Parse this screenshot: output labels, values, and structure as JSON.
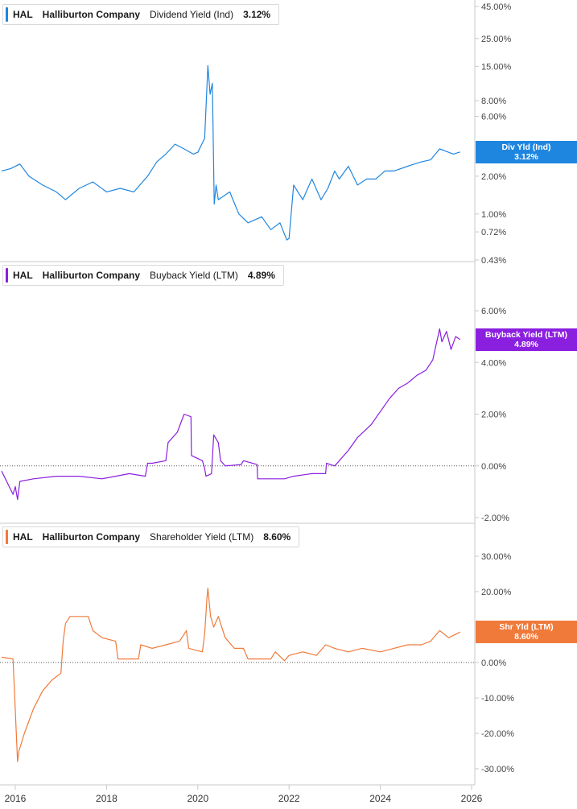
{
  "company": {
    "ticker": "HAL",
    "name": "Halliburton Company"
  },
  "x_axis": {
    "ticks": [
      "2016",
      "2018",
      "2020",
      "2022",
      "2024",
      "2026"
    ]
  },
  "chart_data": [
    {
      "type": "line",
      "series": [
        {
          "name": "Dividend Yield (Ind)",
          "color": "#1f86e0",
          "x": [
            2015.7,
            2015.9,
            2016.1,
            2016.3,
            2016.6,
            2016.9,
            2017.1,
            2017.4,
            2017.7,
            2018.0,
            2018.3,
            2018.6,
            2018.9,
            2019.1,
            2019.3,
            2019.5,
            2019.7,
            2019.9,
            2020.0,
            2020.15,
            2020.22,
            2020.27,
            2020.32,
            2020.36,
            2020.4,
            2020.45,
            2020.7,
            2020.9,
            2021.1,
            2021.4,
            2021.6,
            2021.8,
            2021.95,
            2022.0,
            2022.1,
            2022.3,
            2022.5,
            2022.7,
            2022.85,
            2023.0,
            2023.1,
            2023.3,
            2023.5,
            2023.7,
            2023.9,
            2024.1,
            2024.3,
            2024.6,
            2024.9,
            2025.1,
            2025.3,
            2025.4,
            2025.6,
            2025.75
          ],
          "values": [
            2.2,
            2.3,
            2.5,
            2.0,
            1.7,
            1.5,
            1.3,
            1.6,
            1.8,
            1.5,
            1.6,
            1.5,
            2.0,
            2.6,
            3.0,
            3.6,
            3.3,
            3.0,
            3.1,
            4.0,
            15.2,
            9.0,
            11.0,
            1.2,
            1.7,
            1.3,
            1.5,
            1.0,
            0.85,
            0.95,
            0.75,
            0.85,
            0.62,
            0.64,
            1.7,
            1.3,
            1.9,
            1.3,
            1.6,
            2.2,
            1.9,
            2.4,
            1.7,
            1.9,
            1.9,
            2.2,
            2.2,
            2.4,
            2.6,
            2.7,
            3.3,
            3.2,
            3.0,
            3.12
          ]
        }
      ],
      "ylim": [
        0.43,
        45
      ],
      "y_scale": "log",
      "y_ticks": [
        "0.43%",
        "0.72%",
        "1.00%",
        "2.00%",
        "3.00%",
        "6.00%",
        "8.00%",
        "15.00%",
        "25.00%",
        "45.00%"
      ],
      "legend": {
        "label": "Dividend Yield (Ind)",
        "value": "3.12%"
      },
      "tag": {
        "label": "Div Yld (Ind)",
        "value": "3.12%"
      }
    },
    {
      "type": "line",
      "series": [
        {
          "name": "Buyback Yield (LTM)",
          "color": "#8b1fe0",
          "x": [
            2015.7,
            2015.95,
            2016.0,
            2016.05,
            2016.1,
            2016.4,
            2016.9,
            2017.4,
            2017.9,
            2018.2,
            2018.5,
            2018.85,
            2018.9,
            2019.0,
            2019.3,
            2019.35,
            2019.55,
            2019.7,
            2019.85,
            2019.86,
            2020.1,
            2020.15,
            2020.18,
            2020.3,
            2020.35,
            2020.45,
            2020.5,
            2020.55,
            2020.6,
            2020.95,
            2021.0,
            2021.3,
            2021.31,
            2021.6,
            2021.9,
            2022.1,
            2022.5,
            2022.8,
            2022.82,
            2023.0,
            2023.3,
            2023.5,
            2023.8,
            2024.0,
            2024.2,
            2024.4,
            2024.6,
            2024.8,
            2025.0,
            2025.15,
            2025.3,
            2025.35,
            2025.45,
            2025.55,
            2025.65,
            2025.75
          ],
          "values": [
            -0.2,
            -1.1,
            -0.8,
            -1.3,
            -0.6,
            -0.5,
            -0.4,
            -0.4,
            -0.5,
            -0.4,
            -0.3,
            -0.4,
            0.1,
            0.1,
            0.2,
            0.9,
            1.3,
            2.0,
            1.9,
            0.4,
            0.2,
            -0.1,
            -0.4,
            -0.3,
            1.2,
            0.9,
            0.2,
            0.1,
            0.0,
            0.05,
            0.2,
            0.05,
            -0.5,
            -0.5,
            -0.5,
            -0.4,
            -0.3,
            -0.3,
            0.1,
            0.0,
            0.6,
            1.1,
            1.6,
            2.1,
            2.6,
            3.0,
            3.2,
            3.5,
            3.7,
            4.1,
            5.3,
            4.8,
            5.2,
            4.5,
            5.0,
            4.89
          ]
        }
      ],
      "ylim": [
        -2,
        6
      ],
      "y_ticks": [
        "-2.00%",
        "0.00%",
        "2.00%",
        "4.00%",
        "6.00%"
      ],
      "legend": {
        "label": "Buyback Yield (LTM)",
        "value": "4.89%"
      },
      "tag": {
        "label": "Buyback Yield (LTM)",
        "value": "4.89%"
      }
    },
    {
      "type": "line",
      "series": [
        {
          "name": "Shareholder Yield (LTM)",
          "color": "#f07a3a",
          "x": [
            2015.7,
            2015.95,
            2016.05,
            2016.08,
            2016.2,
            2016.4,
            2016.6,
            2016.8,
            2017.0,
            2017.05,
            2017.1,
            2017.2,
            2017.4,
            2017.6,
            2017.7,
            2017.9,
            2018.2,
            2018.25,
            2018.7,
            2018.75,
            2019.0,
            2019.3,
            2019.6,
            2019.75,
            2019.8,
            2020.1,
            2020.15,
            2020.2,
            2020.22,
            2020.28,
            2020.35,
            2020.45,
            2020.6,
            2020.8,
            2021.0,
            2021.1,
            2021.2,
            2021.6,
            2021.7,
            2021.9,
            2022.0,
            2022.3,
            2022.6,
            2022.8,
            2023.0,
            2023.3,
            2023.6,
            2024.0,
            2024.3,
            2024.6,
            2024.9,
            2025.1,
            2025.3,
            2025.5,
            2025.75
          ],
          "values": [
            1.5,
            1.0,
            -28,
            -25,
            -20,
            -13,
            -8,
            -5,
            -3,
            6,
            11,
            13,
            13,
            13,
            9,
            7,
            6,
            1,
            1,
            5,
            4,
            5,
            6,
            9,
            4,
            3,
            8,
            18,
            21,
            13,
            10,
            13,
            7,
            4,
            4,
            1,
            1,
            1,
            3,
            0.5,
            2,
            3,
            2,
            5,
            4,
            3,
            4,
            3,
            4,
            5,
            5,
            6,
            9,
            7,
            8.6
          ]
        }
      ],
      "ylim": [
        -30,
        30
      ],
      "y_ticks": [
        "-30.00%",
        "-20.00%",
        "-10.00%",
        "0.00%",
        "10.00%",
        "20.00%",
        "30.00%"
      ],
      "legend": {
        "label": "Shareholder Yield (LTM)",
        "value": "8.60%"
      },
      "tag": {
        "label": "Shr Yld (LTM)",
        "value": "8.60%"
      }
    }
  ]
}
